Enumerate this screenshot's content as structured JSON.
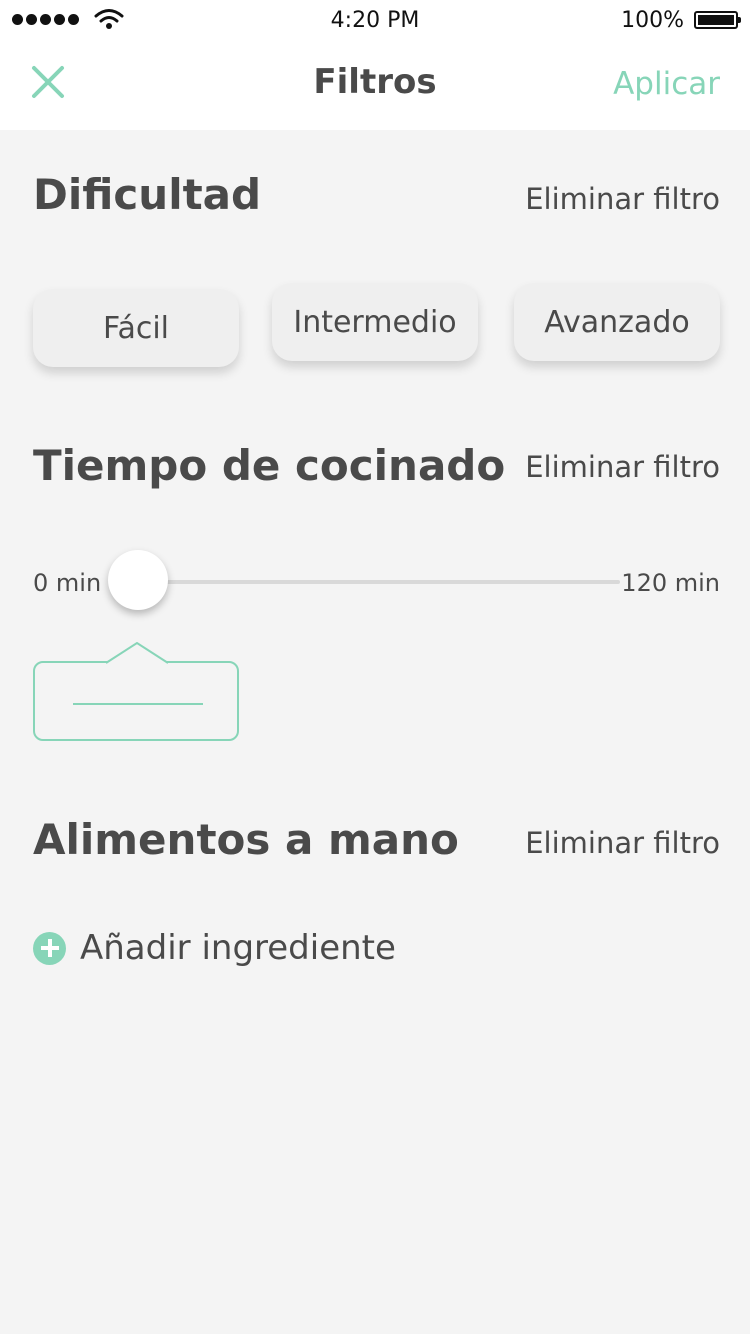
{
  "status_bar": {
    "time": "4:20 PM",
    "battery": "100%"
  },
  "nav": {
    "title": "Filtros",
    "apply_label": "Aplicar",
    "close_icon": "close-icon"
  },
  "difficulty": {
    "title": "Dificultad",
    "remove_label": "Eliminar filtro",
    "options": [
      "Fácil",
      "Intermedio",
      "Avanzado"
    ]
  },
  "cooking_time": {
    "title": "Tiempo de cocinado",
    "remove_label": "Eliminar filtro",
    "min_label": "0 min",
    "max_label": "120 min",
    "value_fraction": 0.0
  },
  "ingredients": {
    "title": "Alimentos a mano",
    "remove_label": "Eliminar filtro",
    "add_label": "Añadir ingrediente"
  },
  "colors": {
    "accent": "#87d5b8",
    "background": "#f4f4f4",
    "text": "#4a4a4a"
  }
}
